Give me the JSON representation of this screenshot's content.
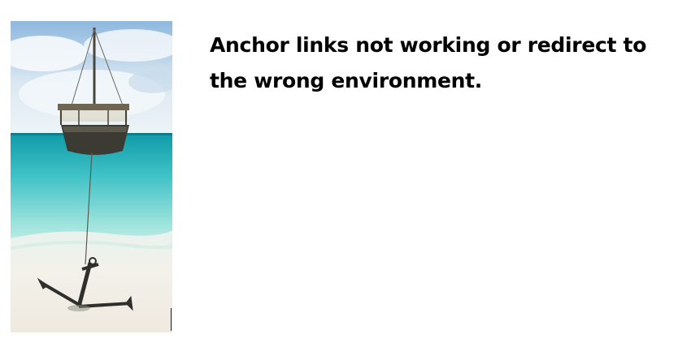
{
  "headline": "Anchor links not working or redirect to the wrong environment.",
  "photo": {
    "subject": "sailing-boat-anchored-on-beach-illustration",
    "colors": {
      "sky_top": "#9fc4e6",
      "sky_bottom": "#e8f1f7",
      "sea_far": "#1aa9b5",
      "sea_near": "#7fdad8",
      "sand": "#f1efe9",
      "hull": "#3b3a33",
      "anchor": "#2f2f2c"
    }
  }
}
